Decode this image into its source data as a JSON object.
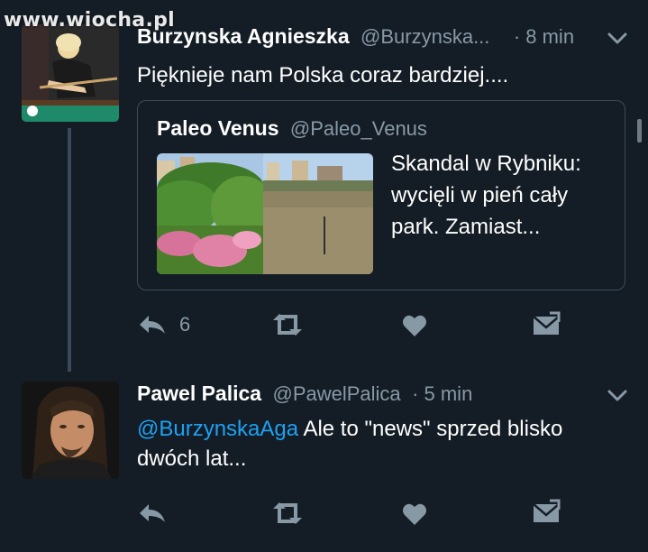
{
  "watermark": "www.wiocha.pl",
  "tweets": [
    {
      "name": "Burzynska Agnieszka",
      "handle": "@Burzynska...",
      "time": "· 8 min",
      "text": "Piękniej​e nam Polska coraz bardziej....",
      "quote": {
        "name": "Paleo Venus",
        "handle": "@Paleo_Venus",
        "text": "Skandal w Rybniku: wycięli w pień cały park. Zamiast..."
      },
      "actions": {
        "reply_count": "6"
      }
    },
    {
      "name": "Pawel Palica",
      "handle": "@PawelPalica",
      "time": "· 5 min",
      "mention": "@BurzynskaAga",
      "text": " Ale to \"news\" sprzed blisko dwóch lat..."
    }
  ],
  "colors": {
    "background": "#141d26",
    "muted": "#8899a6",
    "accent": "#1da1f2"
  },
  "icons": [
    "reply-icon",
    "retweet-icon",
    "like-icon",
    "message-icon",
    "chevron-down-icon"
  ]
}
